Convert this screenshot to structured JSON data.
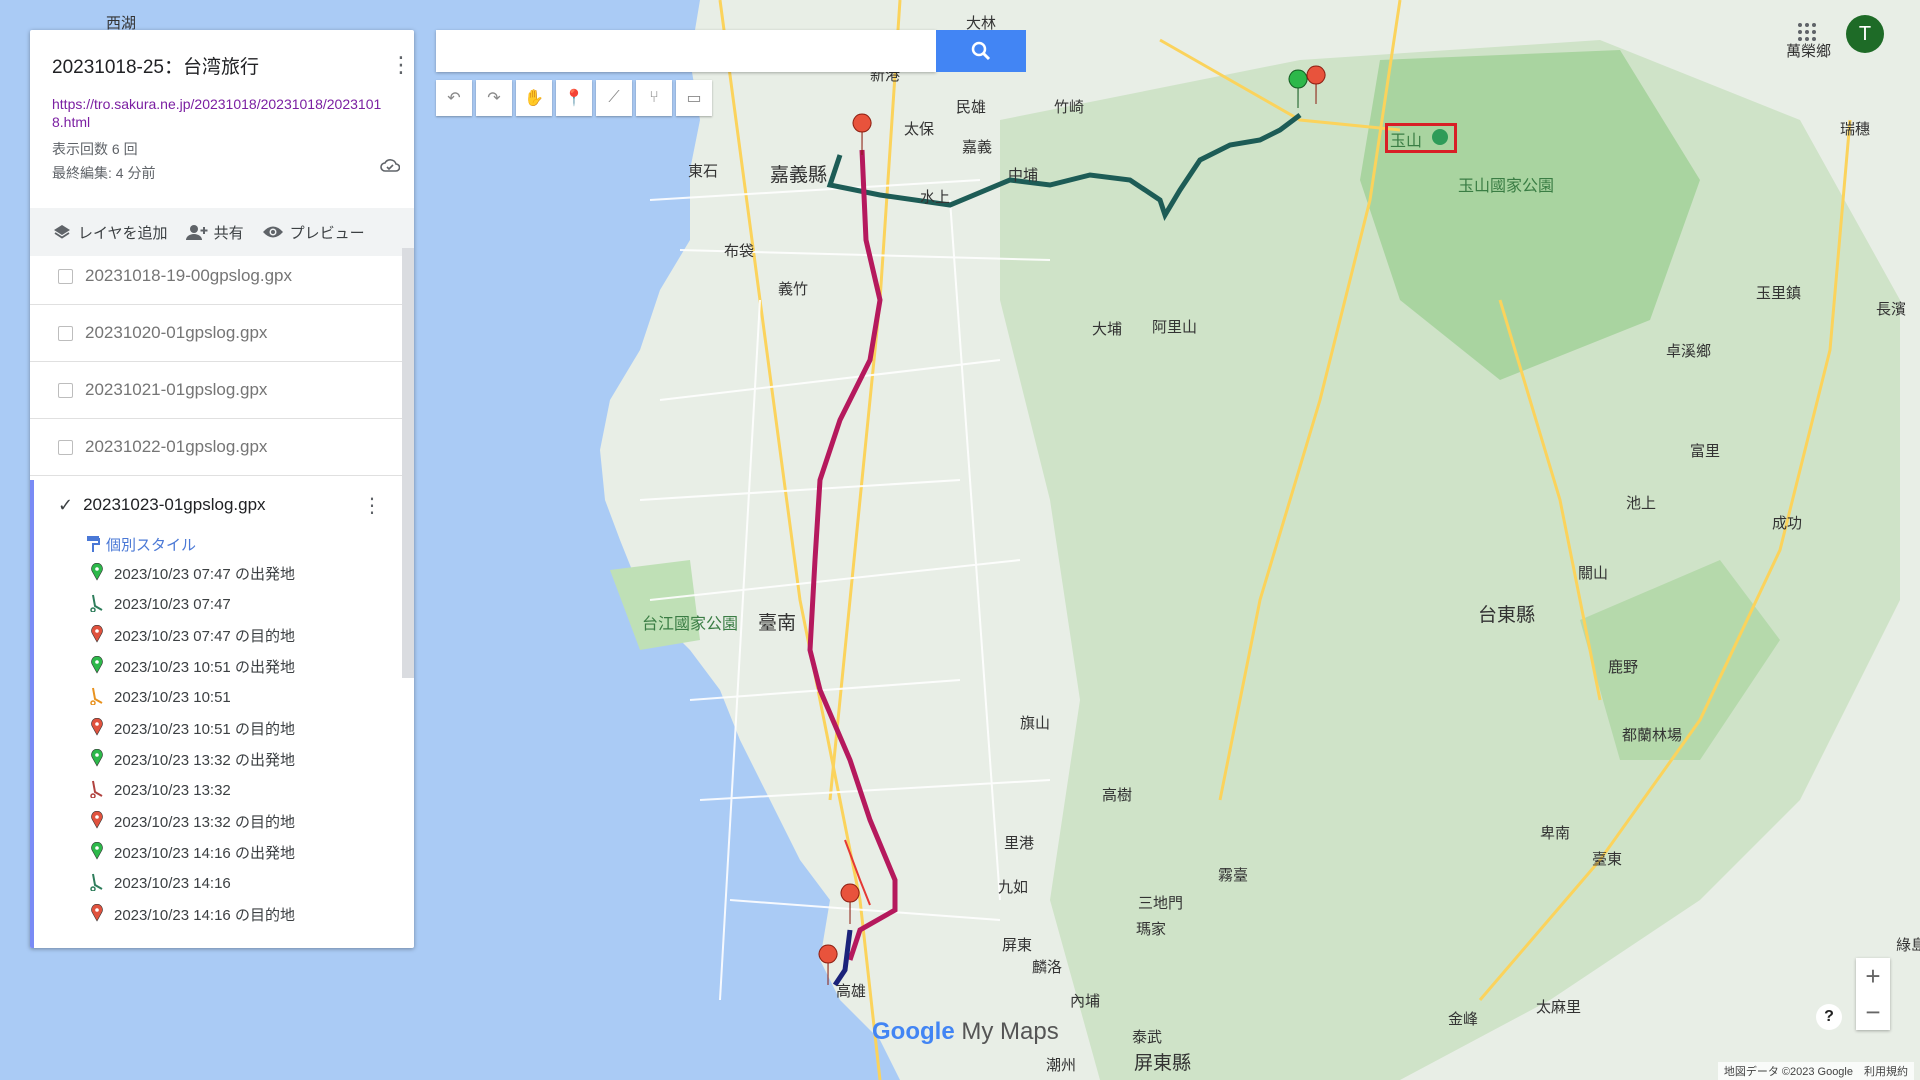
{
  "panel": {
    "title": "20231018-25：台湾旅行",
    "link": "https://tro.sakura.ne.jp/20231018/20231018/20231018.html",
    "views": "表示回数 6 回",
    "last_edited": "最終編集: 4 分前",
    "actions": {
      "add_layer": "レイヤを追加",
      "share": "共有",
      "preview": "プレビュー"
    },
    "layers": [
      {
        "name": "20231018-19-00gpslog.gpx",
        "checked": false
      },
      {
        "name": "20231020-01gpslog.gpx",
        "checked": false
      },
      {
        "name": "20231021-01gpslog.gpx",
        "checked": false
      },
      {
        "name": "20231022-01gpslog.gpx",
        "checked": false
      }
    ],
    "active_layer": {
      "name": "20231023-01gpslog.gpx",
      "checked": true,
      "style_label": "個別スタイル",
      "features": [
        {
          "label": "2023/10/23 07:47 の出発地",
          "icon": "start-marker-icon",
          "color": "#2db84a"
        },
        {
          "label": "2023/10/23 07:47",
          "icon": "route-icon",
          "color": "#2e7d5b"
        },
        {
          "label": "2023/10/23 07:47 の目的地",
          "icon": "end-marker-icon",
          "color": "#e0523e"
        },
        {
          "label": "2023/10/23 10:51 の出発地",
          "icon": "start-marker-icon",
          "color": "#2db84a"
        },
        {
          "label": "2023/10/23 10:51",
          "icon": "route-icon",
          "color": "#e8921f"
        },
        {
          "label": "2023/10/23 10:51 の目的地",
          "icon": "end-marker-icon",
          "color": "#e0523e"
        },
        {
          "label": "2023/10/23 13:32 の出発地",
          "icon": "start-marker-icon",
          "color": "#2db84a"
        },
        {
          "label": "2023/10/23 13:32",
          "icon": "route-icon",
          "color": "#b0413e"
        },
        {
          "label": "2023/10/23 13:32 の目的地",
          "icon": "end-marker-icon",
          "color": "#e0523e"
        },
        {
          "label": "2023/10/23 14:16 の出発地",
          "icon": "start-marker-icon",
          "color": "#2db84a"
        },
        {
          "label": "2023/10/23 14:16",
          "icon": "route-icon",
          "color": "#2e7d5b"
        },
        {
          "label": "2023/10/23 14:16 の目的地",
          "icon": "end-marker-icon",
          "color": "#e0523e"
        }
      ]
    }
  },
  "search": {
    "placeholder": ""
  },
  "user": {
    "initial": "T"
  },
  "map": {
    "labels": {
      "chiayi_county": "嘉義縣",
      "tainan": "臺南",
      "taitung_county": "台東縣",
      "pingtung_county": "屏東縣",
      "yushan": "玉山",
      "yushan_park": "玉山國家公園",
      "taijiang_park": "台江國家公園",
      "alishan": "阿里山",
      "dapu": "大埔",
      "taibao": "太保",
      "minxiong": "民雄",
      "zhongpu": "中埔",
      "shuishang": "水上",
      "chiayi": "嘉義",
      "budai": "布袋",
      "yizhu": "義竹",
      "dongshi": "東石",
      "zhuqi": "竹崎",
      "dalin": "大林",
      "xingang": "新港",
      "wanrong": "萬榮鄉",
      "ruisui": "瑞穗",
      "yuli": "玉里鎮",
      "changbin": "長濱",
      "zhuoxi": "卓溪鄉",
      "fuli": "富里",
      "chishang": "池上",
      "chenggong": "成功",
      "guanshan": "關山",
      "luye": "鹿野",
      "dulan": "都蘭林場",
      "beinan": "卑南",
      "taitung": "臺東",
      "taimali": "太麻里",
      "jinfeng": "金峰",
      "wutai": "霧臺",
      "sandimen": "三地門",
      "majia": "瑪家",
      "gaoshu": "高樹",
      "qishan": "旗山",
      "ligang": "里港",
      "jiuru": "九如",
      "pingtung": "屏東",
      "linluo": "麟洛",
      "neipu": "內埔",
      "taiwu": "泰武",
      "chaozhou": "潮州",
      "lidao": "綠島",
      "kaohsiung": "高雄",
      "xihu": "西湖"
    }
  },
  "watermark": {
    "google": "Google",
    "mymaps": "My Maps"
  },
  "attribution": "地図データ ©2023 Google　利用規約"
}
